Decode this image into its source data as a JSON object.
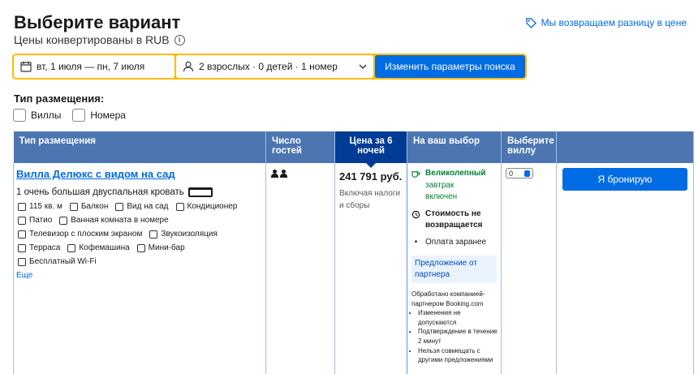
{
  "header": {
    "title": "Выберите вариант",
    "subtitle": "Цены конвертированы в RUB",
    "price_difference": "Мы возвращаем разницу в цене"
  },
  "search": {
    "dates": "вт, 1 июля — пн, 7 июля",
    "guests": "2 взрослых · 0 детей · 1 номер",
    "button": "Изменить параметры поиска"
  },
  "filters": {
    "title": "Тип размещения:",
    "options": [
      "Виллы",
      "Номера"
    ]
  },
  "table": {
    "headers": [
      "Тип размещения",
      "Число гостей",
      "Цена за 6 ночей",
      "На ваш выбор",
      "Выберите виллу",
      ""
    ]
  },
  "room": {
    "name": "Вилла Делюкс с видом на сад",
    "bed": "1 очень большая двуспальная кровать",
    "amenities": [
      "115 кв. м",
      "Балкон",
      "Вид на сад",
      "Кондиционер",
      "Патио",
      "Ванная комната в номере",
      "Телевизор с плоским экраном",
      "Звукоизоляция",
      "Терраса",
      "Кофемашина",
      "Мини-бар",
      "Бесплатный Wi-Fi"
    ],
    "more": "Еще",
    "guests_count": 2,
    "price": "241 791 руб.",
    "price_note": "Включая налоги и сборы",
    "choice": {
      "breakfast_title": "Великолепный",
      "breakfast_line2": "завтрак",
      "breakfast_line3": "включен",
      "refund_line1": "Стоимость не",
      "refund_line2": "возвращается",
      "prepay": "Оплата заранее",
      "partner_label": "Предложение от партнера",
      "partner_text": "Обработано компанией-партнером Booking.com",
      "partner_bullets": [
        "Изменения не допускаются",
        "Подтверждение в течение 2 минут",
        "Нельзя совмещать с другими предложениями"
      ]
    },
    "select_value": "0",
    "book_button": "Я бронирую"
  },
  "colors": {
    "accent": "#006ce4",
    "header_bg": "#4c76b2",
    "price_header_bg": "#003b95",
    "search_border": "#febb02",
    "green": "#008234"
  }
}
